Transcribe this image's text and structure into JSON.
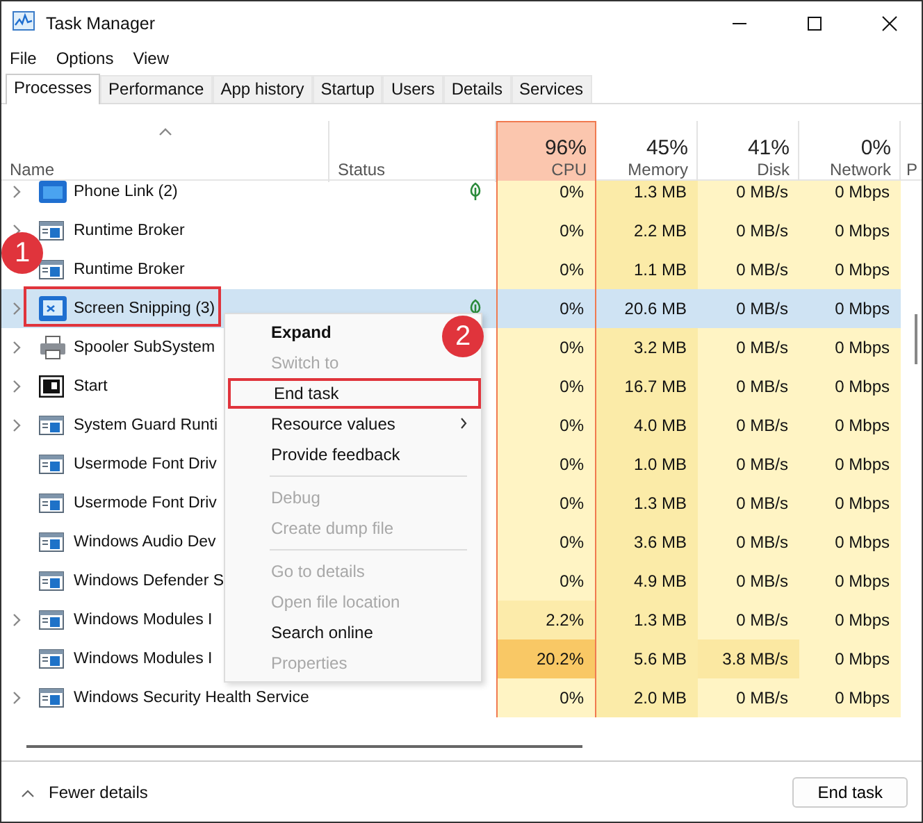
{
  "window": {
    "title": "Task Manager"
  },
  "menu_bar": [
    "File",
    "Options",
    "View"
  ],
  "tabs": [
    {
      "label": "Processes",
      "selected": true
    },
    {
      "label": "Performance",
      "selected": false
    },
    {
      "label": "App history",
      "selected": false
    },
    {
      "label": "Startup",
      "selected": false
    },
    {
      "label": "Users",
      "selected": false
    },
    {
      "label": "Details",
      "selected": false
    },
    {
      "label": "Services",
      "selected": false
    }
  ],
  "columns": [
    {
      "label": "Name",
      "highlighted": false
    },
    {
      "label": "Status",
      "highlighted": false
    },
    {
      "label": "CPU",
      "percent": "96%",
      "highlighted": true
    },
    {
      "label": "Memory",
      "percent": "45%",
      "highlighted": false
    },
    {
      "label": "Disk",
      "percent": "41%",
      "highlighted": false
    },
    {
      "label": "Network",
      "percent": "0%",
      "highlighted": false
    },
    {
      "label": "P",
      "highlighted": false
    }
  ],
  "rows": [
    {
      "name": "Phone Link (2)",
      "kind": "phone",
      "expandable": true,
      "efficiency": true,
      "selected": false,
      "cells": [
        {
          "text": "0%",
          "color": "#fff4c4"
        },
        {
          "text": "1.3 MB",
          "color": "#fbeba8"
        },
        {
          "text": "0 MB/s",
          "color": "#fff4c4"
        },
        {
          "text": "0 Mbps",
          "color": "#fff4c4"
        }
      ]
    },
    {
      "name": "Runtime Broker",
      "kind": "app",
      "expandable": true,
      "efficiency": false,
      "selected": false,
      "cells": [
        {
          "text": "0%",
          "color": "#fff4c4"
        },
        {
          "text": "2.2 MB",
          "color": "#fbeba8"
        },
        {
          "text": "0 MB/s",
          "color": "#fff4c4"
        },
        {
          "text": "0 Mbps",
          "color": "#fff4c4"
        }
      ]
    },
    {
      "name": "Runtime Broker",
      "kind": "app",
      "expandable": false,
      "efficiency": false,
      "selected": false,
      "cells": [
        {
          "text": "0%",
          "color": "#fff4c4"
        },
        {
          "text": "1.1 MB",
          "color": "#fbeba8"
        },
        {
          "text": "0 MB/s",
          "color": "#fff4c4"
        },
        {
          "text": "0 Mbps",
          "color": "#fff4c4"
        }
      ]
    },
    {
      "name": "Screen Snipping (3)",
      "kind": "snip",
      "expandable": true,
      "efficiency": true,
      "selected": true,
      "cells": [
        {
          "text": "0%"
        },
        {
          "text": "20.6 MB"
        },
        {
          "text": "0 MB/s"
        },
        {
          "text": "0 Mbps"
        }
      ]
    },
    {
      "name": "Spooler SubSystem",
      "kind": "printer",
      "expandable": true,
      "efficiency": false,
      "selected": false,
      "cells": [
        {
          "text": "0%",
          "color": "#fff4c4"
        },
        {
          "text": "3.2 MB",
          "color": "#fbeba8"
        },
        {
          "text": "0 MB/s",
          "color": "#fff4c4"
        },
        {
          "text": "0 Mbps",
          "color": "#fff4c4"
        }
      ]
    },
    {
      "name": "Start",
      "kind": "start",
      "expandable": true,
      "efficiency": false,
      "selected": false,
      "cells": [
        {
          "text": "0%",
          "color": "#fff4c4"
        },
        {
          "text": "16.7 MB",
          "color": "#fbeba8"
        },
        {
          "text": "0 MB/s",
          "color": "#fff4c4"
        },
        {
          "text": "0 Mbps",
          "color": "#fff4c4"
        }
      ]
    },
    {
      "name": "System Guard Runti",
      "kind": "app",
      "expandable": true,
      "efficiency": false,
      "selected": false,
      "cells": [
        {
          "text": "0%",
          "color": "#fff4c4"
        },
        {
          "text": "4.0 MB",
          "color": "#fbeba8"
        },
        {
          "text": "0 MB/s",
          "color": "#fff4c4"
        },
        {
          "text": "0 Mbps",
          "color": "#fff4c4"
        }
      ]
    },
    {
      "name": "Usermode Font Driv",
      "kind": "app",
      "expandable": false,
      "efficiency": false,
      "selected": false,
      "cells": [
        {
          "text": "0%",
          "color": "#fff4c4"
        },
        {
          "text": "1.0 MB",
          "color": "#fbeba8"
        },
        {
          "text": "0 MB/s",
          "color": "#fff4c4"
        },
        {
          "text": "0 Mbps",
          "color": "#fff4c4"
        }
      ]
    },
    {
      "name": "Usermode Font Driv",
      "kind": "app",
      "expandable": false,
      "efficiency": false,
      "selected": false,
      "cells": [
        {
          "text": "0%",
          "color": "#fff4c4"
        },
        {
          "text": "1.3 MB",
          "color": "#fbeba8"
        },
        {
          "text": "0 MB/s",
          "color": "#fff4c4"
        },
        {
          "text": "0 Mbps",
          "color": "#fff4c4"
        }
      ]
    },
    {
      "name": "Windows Audio Dev",
      "kind": "app",
      "expandable": false,
      "efficiency": false,
      "selected": false,
      "cells": [
        {
          "text": "0%",
          "color": "#fff4c4"
        },
        {
          "text": "3.6 MB",
          "color": "#fbeba8"
        },
        {
          "text": "0 MB/s",
          "color": "#fff4c4"
        },
        {
          "text": "0 Mbps",
          "color": "#fff4c4"
        }
      ]
    },
    {
      "name": "Windows Defender S",
      "kind": "app",
      "expandable": false,
      "efficiency": false,
      "selected": false,
      "cells": [
        {
          "text": "0%",
          "color": "#fff4c4"
        },
        {
          "text": "4.9 MB",
          "color": "#fbeba8"
        },
        {
          "text": "0 MB/s",
          "color": "#fff4c4"
        },
        {
          "text": "0 Mbps",
          "color": "#fff4c4"
        }
      ]
    },
    {
      "name": "Windows Modules I",
      "kind": "app",
      "expandable": true,
      "efficiency": false,
      "selected": false,
      "cells": [
        {
          "text": "2.2%",
          "color": "#fcebaa"
        },
        {
          "text": "1.3 MB",
          "color": "#fbeba8"
        },
        {
          "text": "0 MB/s",
          "color": "#fff4c4"
        },
        {
          "text": "0 Mbps",
          "color": "#fff4c4"
        }
      ]
    },
    {
      "name": "Windows Modules I",
      "kind": "app",
      "expandable": false,
      "efficiency": false,
      "selected": false,
      "cells": [
        {
          "text": "20.2%",
          "color": "#f9c865"
        },
        {
          "text": "5.6 MB",
          "color": "#fbeba8"
        },
        {
          "text": "3.8 MB/s",
          "color": "#fbe8a2"
        },
        {
          "text": "0 Mbps",
          "color": "#fff4c4"
        }
      ]
    },
    {
      "name": "Windows Security Health Service",
      "kind": "app",
      "expandable": true,
      "efficiency": false,
      "selected": false,
      "cells": [
        {
          "text": "0%",
          "color": "#fff4c4"
        },
        {
          "text": "2.0 MB",
          "color": "#fbeba8"
        },
        {
          "text": "0 MB/s",
          "color": "#fff4c4"
        },
        {
          "text": "0 Mbps",
          "color": "#fff4c4"
        }
      ]
    }
  ],
  "context_menu": {
    "items": [
      {
        "kind": "item",
        "label": "Expand",
        "bold": true,
        "disabled": false,
        "submenu": false,
        "highlighted": false
      },
      {
        "kind": "item",
        "label": "Switch to",
        "bold": false,
        "disabled": true,
        "submenu": false,
        "highlighted": false
      },
      {
        "kind": "item",
        "label": "End task",
        "bold": false,
        "disabled": false,
        "submenu": false,
        "highlighted": true
      },
      {
        "kind": "item",
        "label": "Resource values",
        "bold": false,
        "disabled": false,
        "submenu": true,
        "highlighted": false
      },
      {
        "kind": "item",
        "label": "Provide feedback",
        "bold": false,
        "disabled": false,
        "submenu": false,
        "highlighted": false
      },
      {
        "kind": "separator"
      },
      {
        "kind": "item",
        "label": "Debug",
        "bold": false,
        "disabled": true,
        "submenu": false,
        "highlighted": false
      },
      {
        "kind": "item",
        "label": "Create dump file",
        "bold": false,
        "disabled": true,
        "submenu": false,
        "highlighted": false
      },
      {
        "kind": "separator"
      },
      {
        "kind": "item",
        "label": "Go to details",
        "bold": false,
        "disabled": true,
        "submenu": false,
        "highlighted": false
      },
      {
        "kind": "item",
        "label": "Open file location",
        "bold": false,
        "disabled": true,
        "submenu": false,
        "highlighted": false
      },
      {
        "kind": "item",
        "label": "Search online",
        "bold": false,
        "disabled": false,
        "submenu": false,
        "highlighted": false
      },
      {
        "kind": "item",
        "label": "Properties",
        "bold": false,
        "disabled": true,
        "submenu": false,
        "highlighted": false
      }
    ]
  },
  "annotations": [
    "1",
    "2"
  ],
  "footer": {
    "toggle": "Fewer details",
    "button": "End task"
  }
}
